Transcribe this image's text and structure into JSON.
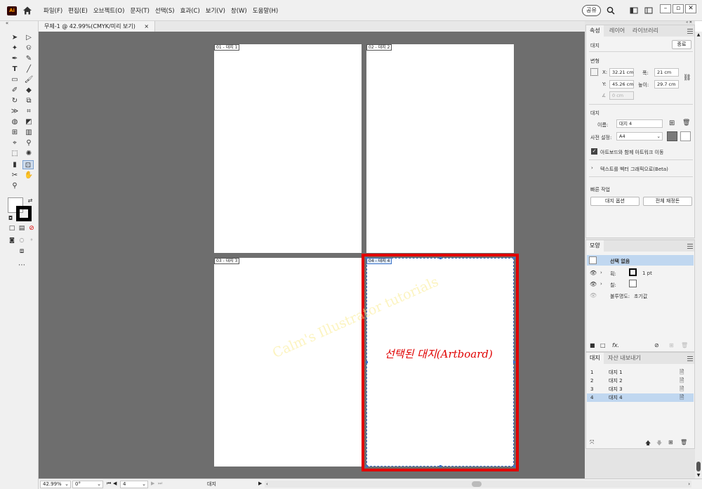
{
  "app": {
    "logo": "Ai"
  },
  "menu": [
    "파일(F)",
    "편집(E)",
    "오브젝트(O)",
    "문자(T)",
    "선택(S)",
    "효과(C)",
    "보기(V)",
    "창(W)",
    "도움말(H)"
  ],
  "top_right": {
    "share_label": "공유"
  },
  "document_tab": {
    "title": "무제-1 @ 42.99%(CMYK/미리 보기)",
    "close": "×"
  },
  "artboards": [
    {
      "label": "01 - 대지 1"
    },
    {
      "label": "02 - 대지 2"
    },
    {
      "label": "03 - 대지 3"
    },
    {
      "label": "04 - 대지 4"
    }
  ],
  "annotation": {
    "text": "선택된 대지(Artboard)"
  },
  "watermark": {
    "text": "Calm's Illustrator tutorials"
  },
  "status": {
    "zoom": "42.99%",
    "rotation": "0°",
    "artboard_nav": "4",
    "mode": "대지"
  },
  "properties": {
    "tabs": [
      "속성",
      "레이어",
      "라이브러리"
    ],
    "section_artboard": "대지",
    "end_button": "종료",
    "transform_title": "변형",
    "x_label": "X:",
    "x_value": "32.21 cm",
    "y_label": "Y:",
    "y_value": "45.26 cm",
    "w_label": "폭:",
    "w_value": "21 cm",
    "h_label": "높이:",
    "h_value": "29.7 cm",
    "rotation_value": "0 cm",
    "artboard_title": "대지",
    "name_label": "이름:",
    "name_value": "대지 4",
    "preset_label": "사전 설정:",
    "preset_value": "A4",
    "move_artwork_label": "아트보드와 함께 아트워크 이동",
    "move_artwork_checked": true,
    "text_to_vector": "텍스트를 벡터 그래픽으로(Beta)",
    "quick_actions_title": "빠른 작업",
    "artboard_options_button": "대지 옵션",
    "rearrange_all_button": "전체 재정돈"
  },
  "appearance": {
    "tab": "모양",
    "no_selection": "선택 없음",
    "stroke_label": "획:",
    "stroke_weight": "1 pt",
    "fill_label": "칠:",
    "opacity_label": "불투명도:",
    "opacity_value": "초기값"
  },
  "artboards_panel": {
    "tabs": [
      "대지",
      "자산 내보내기"
    ],
    "rows": [
      {
        "num": "1",
        "name": "대지 1"
      },
      {
        "num": "2",
        "name": "대지 2"
      },
      {
        "num": "3",
        "name": "대지 3"
      },
      {
        "num": "4",
        "name": "대지 4"
      }
    ],
    "selected_index": 3
  },
  "colors": {
    "accent": "#3b73c8",
    "highlight": "#e10000",
    "selection_row": "#c0d7f0"
  }
}
